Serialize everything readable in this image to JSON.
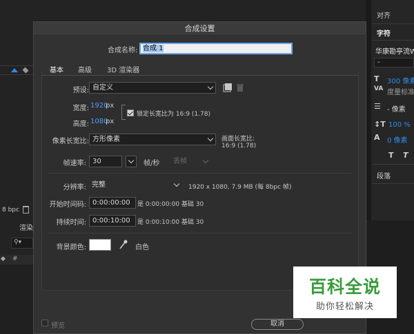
{
  "dialog": {
    "title": "合成设置",
    "name_label": "合成名称:",
    "name_value": "合成 1",
    "tabs": [
      {
        "label": "基本",
        "active": true
      },
      {
        "label": "高级",
        "active": false
      },
      {
        "label": "3D 渲染器",
        "active": false
      }
    ],
    "preset_label": "预设:",
    "preset_value": "自定义",
    "width_label": "宽度:",
    "width_value": "1920",
    "width_unit": "px",
    "height_label": "高度:",
    "height_value": "1080",
    "height_unit": "px",
    "lock_aspect_label": "锁定长宽比为 16:9 (1.78)",
    "lock_aspect_checked": true,
    "pixel_aspect_label": "像素长宽比:",
    "pixel_aspect_value": "方形像素",
    "frame_aspect_label": "画面长宽比:",
    "frame_aspect_value": "16:9 (1.78)",
    "frame_rate_label": "帧速率:",
    "frame_rate_value": "30",
    "frame_rate_unit": "帧/秒",
    "drop_frame_value": "丢帧",
    "resolution_label": "分辨率:",
    "resolution_value": "完整",
    "resolution_info": "1920 x 1080, 7.9 MB (每 8bpc 帧)",
    "start_timecode_label": "开始时间码:",
    "start_timecode_value": "0:00:00:00",
    "start_timecode_info": "是 0:00:00:00  基础 30",
    "duration_label": "持续时间:",
    "duration_value": "0:00:10:00",
    "duration_info": "是 0:00:10:00  基础 30",
    "bg_color_label": "背景颜色:",
    "bg_color_hex": "#ffffff",
    "bg_color_name": "白色",
    "preview_label": "预览",
    "cancel_label": "取消"
  },
  "background": {
    "bpc_label": "8 bpc",
    "render_label": "渲染",
    "right_panel": {
      "align_label": "对齐",
      "character_label": "字符",
      "font_name": "华康勘亭流W",
      "font_style": "-",
      "font_size": "300 像素",
      "kerning_label": "度量标准",
      "leading": "- 像素",
      "vertical_scale": "100 %",
      "baseline_shift": "0 像素",
      "paragraph_label": "段落"
    }
  },
  "watermark": {
    "title": "百科全说",
    "subtitle": "助你轻松解决"
  },
  "colors": {
    "accent_blue": "#2d8ceb",
    "value_blue": "#4a9fff",
    "dialog_bg": "#323232",
    "watermark_green": "#3a9b3a"
  }
}
